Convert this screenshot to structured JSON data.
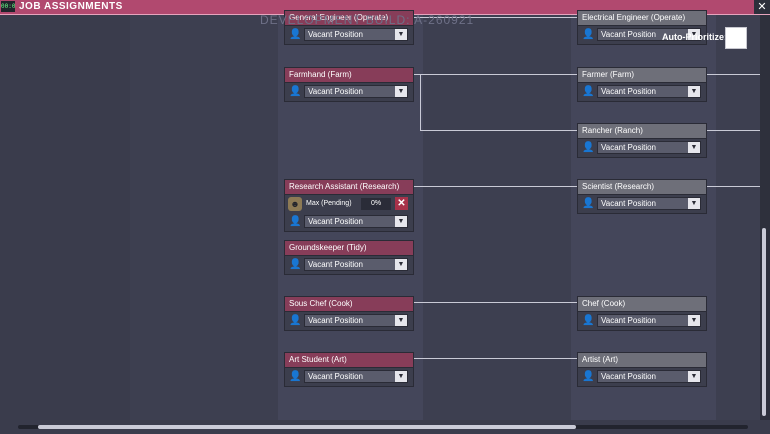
{
  "window": {
    "title": "JOB ASSIGNMENTS",
    "icon_text": "00:00",
    "close_glyph": "✕"
  },
  "watermark": "DEVELOPMENT BUILD: A-260921",
  "auto_prioritize": {
    "label": "Auto-Prioritize:",
    "checked": false
  },
  "vacant_label": "Vacant Position",
  "icons": {
    "person": "person-silhouette-icon",
    "dropdown": "chevron-down-icon"
  },
  "jobs_left": [
    {
      "title": "General Engineer (Operate)",
      "slot": "Vacant Position"
    },
    {
      "title": "Farmhand (Farm)",
      "slot": "Vacant Position"
    },
    {
      "title": "Research Assistant (Research)",
      "pending": {
        "label": "Max (Pending)",
        "percent": "0%",
        "remove_glyph": "✕"
      },
      "slot": "Vacant Position"
    },
    {
      "title": "Groundskeeper (Tidy)",
      "slot": "Vacant Position"
    },
    {
      "title": "Sous Chef (Cook)",
      "slot": "Vacant Position"
    },
    {
      "title": "Art Student (Art)",
      "slot": "Vacant Position"
    }
  ],
  "jobs_right": [
    {
      "title": "Electrical Engineer (Operate)",
      "slot": "Vacant Position"
    },
    {
      "title": "Farmer (Farm)",
      "slot": "Vacant Position"
    },
    {
      "title": "Rancher (Ranch)",
      "slot": "Vacant Position"
    },
    {
      "title": "Scientist (Research)",
      "slot": "Vacant Position"
    },
    {
      "title": "Chef (Cook)",
      "slot": "Vacant Position"
    },
    {
      "title": "Artist (Art)",
      "slot": "Vacant Position"
    }
  ],
  "colors": {
    "title_bar": "#b1496f",
    "student_header": "#873d59",
    "master_header": "#6e6f79",
    "background": "#3a3b4a"
  }
}
